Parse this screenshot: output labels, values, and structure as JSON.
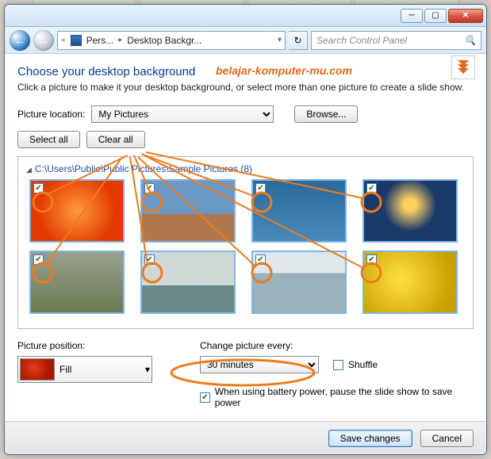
{
  "window": {
    "breadcrumb_back": "«",
    "breadcrumb_1": "Pers...",
    "breadcrumb_2": "Desktop Backgr...",
    "search_placeholder": "Search Control Panel"
  },
  "header": {
    "title": "Choose your desktop background",
    "watermark": "belajar-komputer-mu.com",
    "subtitle": "Click a picture to make it your desktop background, or select more than one picture to create a slide show."
  },
  "location": {
    "label": "Picture location:",
    "value": "My Pictures",
    "browse": "Browse..."
  },
  "selection": {
    "select_all": "Select all",
    "clear_all": "Clear all"
  },
  "group": {
    "path": "C:\\Users\\Public\\Public Pictures\\Sample Pictures (8)"
  },
  "position": {
    "label": "Picture position:",
    "value": "Fill"
  },
  "change": {
    "label": "Change picture every:",
    "value": "30 minutes",
    "shuffle": "Shuffle",
    "battery": "When using battery power, pause the slide show to save power"
  },
  "buttons": {
    "save": "Save changes",
    "cancel": "Cancel"
  }
}
